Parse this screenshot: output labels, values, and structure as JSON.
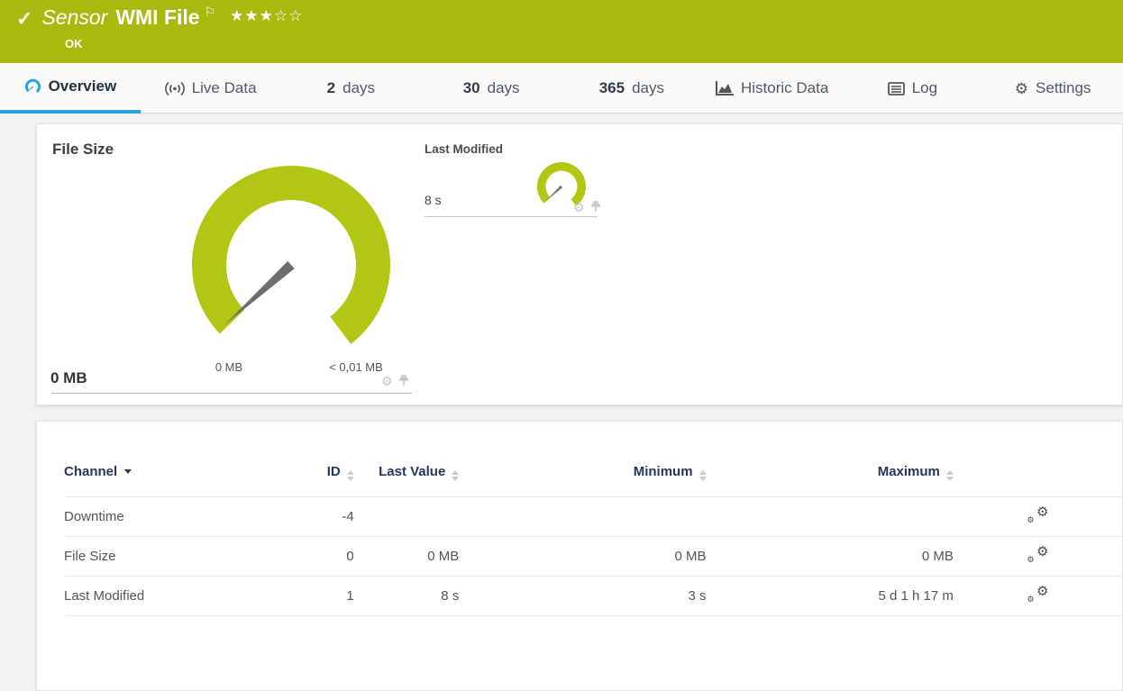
{
  "colors": {
    "brand_green": "#a9ba0f",
    "gauge_green": "#b2c713",
    "accent_blue": "#2fa2da",
    "table_header_text": "#25355c"
  },
  "header": {
    "kind_label": "Sensor",
    "title": "WMI File",
    "status": "OK",
    "rating": {
      "filled": 3,
      "total": 5,
      "stars_filled": "★★★",
      "stars_empty": "☆☆"
    }
  },
  "tabs": [
    {
      "label": "Overview",
      "icon": "gauge-icon",
      "active": true
    },
    {
      "label": "Live Data",
      "icon": "live-icon"
    },
    {
      "prefix": "2",
      "label": "days"
    },
    {
      "prefix": "30",
      "label": "days"
    },
    {
      "prefix": "365",
      "label": "days"
    },
    {
      "label": "Historic Data",
      "icon": "area-chart-icon"
    },
    {
      "label": "Log",
      "icon": "log-icon"
    },
    {
      "label": "Settings",
      "icon": "gear-icon"
    }
  ],
  "gauges": {
    "file_size": {
      "title": "File Size",
      "value": "0 MB",
      "min_label": "0 MB",
      "max_label": "< 0,01 MB"
    },
    "last_modified": {
      "title": "Last Modified",
      "value": "8 s"
    }
  },
  "channels": {
    "columns": {
      "channel": "Channel",
      "id": "ID",
      "last": "Last Value",
      "min": "Minimum",
      "max": "Maximum"
    },
    "rows": [
      {
        "channel": "Downtime",
        "id": "-4",
        "last": "",
        "min": "",
        "max": ""
      },
      {
        "channel": "File Size",
        "id": "0",
        "last": "0 MB",
        "min": "0 MB",
        "max": "0 MB"
      },
      {
        "channel": "Last Modified",
        "id": "1",
        "last": "8 s",
        "min": "3 s",
        "max": "5 d 1 h 17 m"
      }
    ]
  }
}
